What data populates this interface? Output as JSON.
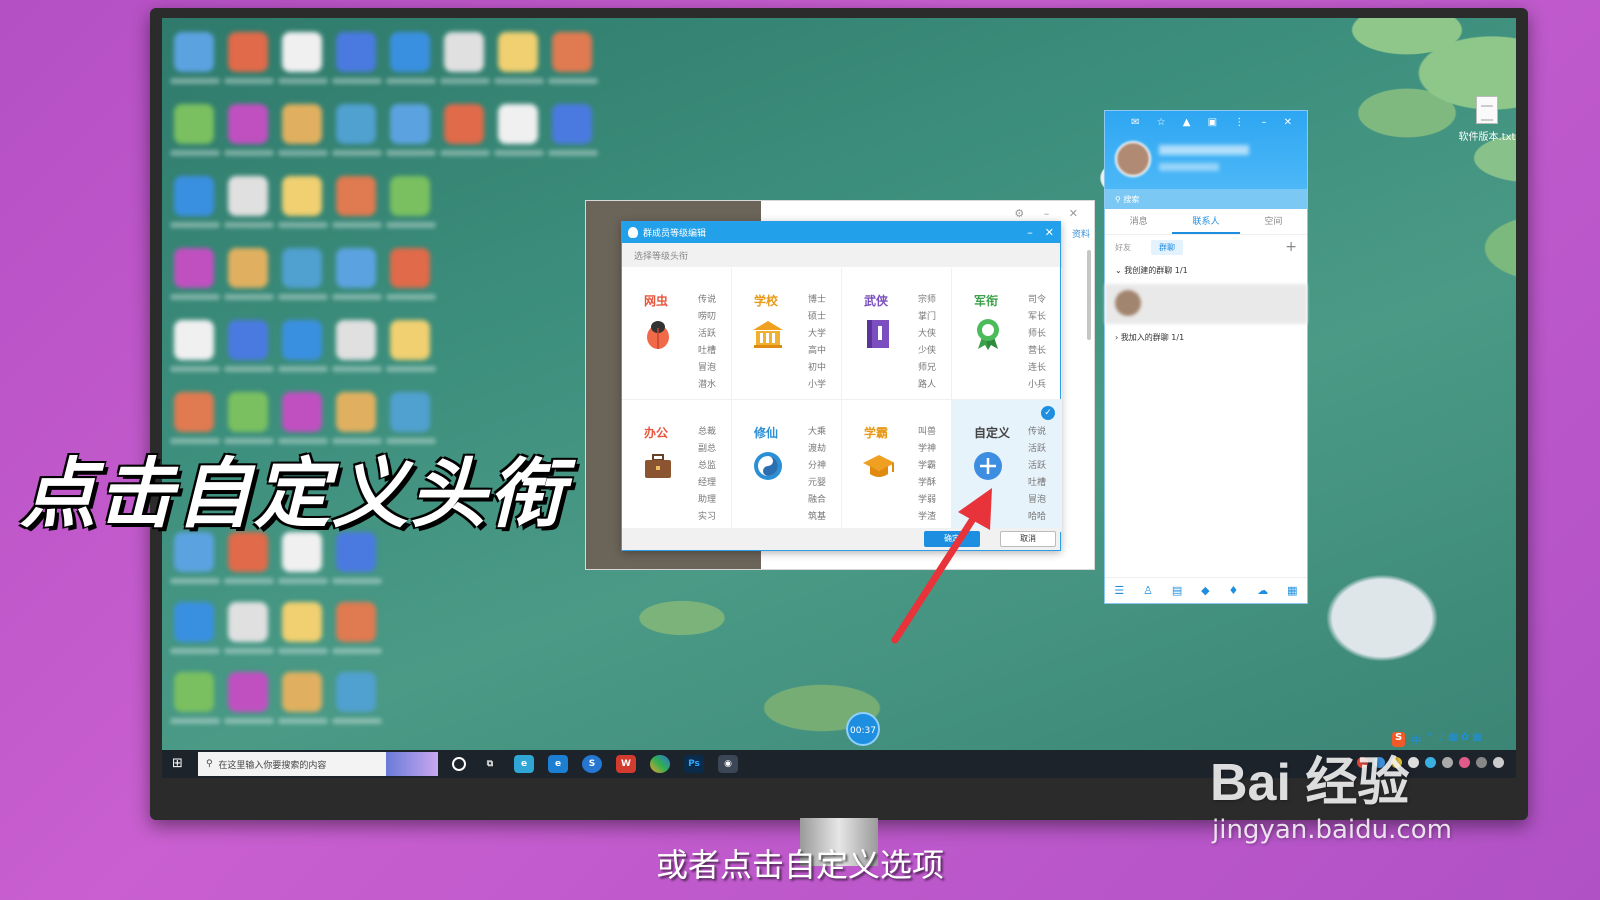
{
  "overlay": {
    "caption": "点击自定义头衔",
    "subtitle": "或者点击自定义选项",
    "watermark_logo": "Bai 经验",
    "watermark_url": "jingyan.baidu.com"
  },
  "desktop": {
    "right_file_label": "软件版本.txt"
  },
  "dialog": {
    "title": "群成员等级编辑",
    "subtitle": "选择等级头衔",
    "categories": [
      {
        "name": "网虫",
        "color": "#e8553d",
        "icon": "bug-icon",
        "levels": [
          "传说",
          "唠叨",
          "活跃",
          "吐槽",
          "冒泡",
          "潜水"
        ]
      },
      {
        "name": "学校",
        "color": "#e89a1a",
        "icon": "school-icon",
        "levels": [
          "博士",
          "硕士",
          "大学",
          "高中",
          "初中",
          "小学"
        ]
      },
      {
        "name": "武侠",
        "color": "#7b4fbf",
        "icon": "book-icon",
        "levels": [
          "宗师",
          "掌门",
          "大侠",
          "少侠",
          "师兄",
          "路人"
        ]
      },
      {
        "name": "军衔",
        "color": "#3aa14a",
        "icon": "medal-icon",
        "levels": [
          "司令",
          "军长",
          "师长",
          "营长",
          "连长",
          "小兵"
        ]
      },
      {
        "name": "办公",
        "color": "#e8553d",
        "icon": "briefcase-icon",
        "levels": [
          "总裁",
          "副总",
          "总监",
          "经理",
          "助理",
          "实习"
        ]
      },
      {
        "name": "修仙",
        "color": "#2b8fd6",
        "icon": "taiji-icon",
        "levels": [
          "大乘",
          "渡劫",
          "分神",
          "元婴",
          "融合",
          "筑基"
        ]
      },
      {
        "name": "学霸",
        "color": "#e89a1a",
        "icon": "graduation-cap-icon",
        "levels": [
          "叫兽",
          "学神",
          "学霸",
          "学酥",
          "学弱",
          "学渣"
        ]
      },
      {
        "name": "自定义",
        "color": "#444444",
        "icon": "custom-icon",
        "levels": [
          "传说",
          "活跃",
          "活跃",
          "吐槽",
          "冒泡",
          "哈哈"
        ],
        "selected": true
      }
    ],
    "ok_label": "确定",
    "cancel_label": "取消"
  },
  "qq": {
    "search_placeholder": "搜索",
    "tabs": [
      "消息",
      "联系人",
      "空间"
    ],
    "active_tab": "联系人",
    "sub_tabs": [
      "好友",
      "群聊"
    ],
    "created_groups": "我创建的群聊 1/1",
    "joined_groups": "我加入的群聊 1/1"
  },
  "taskbar": {
    "search_placeholder": "在这里输入你要搜索的内容",
    "timer": "00:37",
    "ime": "中"
  },
  "colors": {
    "accent": "#1e8fe0",
    "arrow": "#e8333a"
  }
}
